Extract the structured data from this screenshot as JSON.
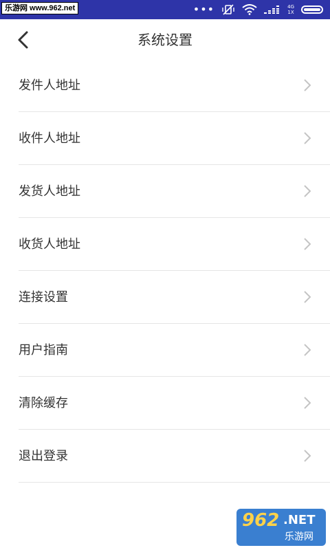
{
  "status_bar": {
    "watermark": "乐游网 www.962.net",
    "network": "4G\n1X"
  },
  "header": {
    "title": "系统设置"
  },
  "settings": {
    "items": [
      {
        "label": "发件人地址"
      },
      {
        "label": "收件人地址"
      },
      {
        "label": "发货人地址"
      },
      {
        "label": "收货人地址"
      },
      {
        "label": "连接设置"
      },
      {
        "label": "用户指南"
      },
      {
        "label": "清除缓存"
      },
      {
        "label": "退出登录"
      }
    ]
  },
  "watermark_badge": {
    "number": "962",
    "net": ".NET",
    "cn": "乐游网"
  },
  "colors": {
    "status_bar_bg": "#2e34a8",
    "divider": "#e5e5e5",
    "chevron": "#c4c4c4",
    "text": "#333333"
  }
}
